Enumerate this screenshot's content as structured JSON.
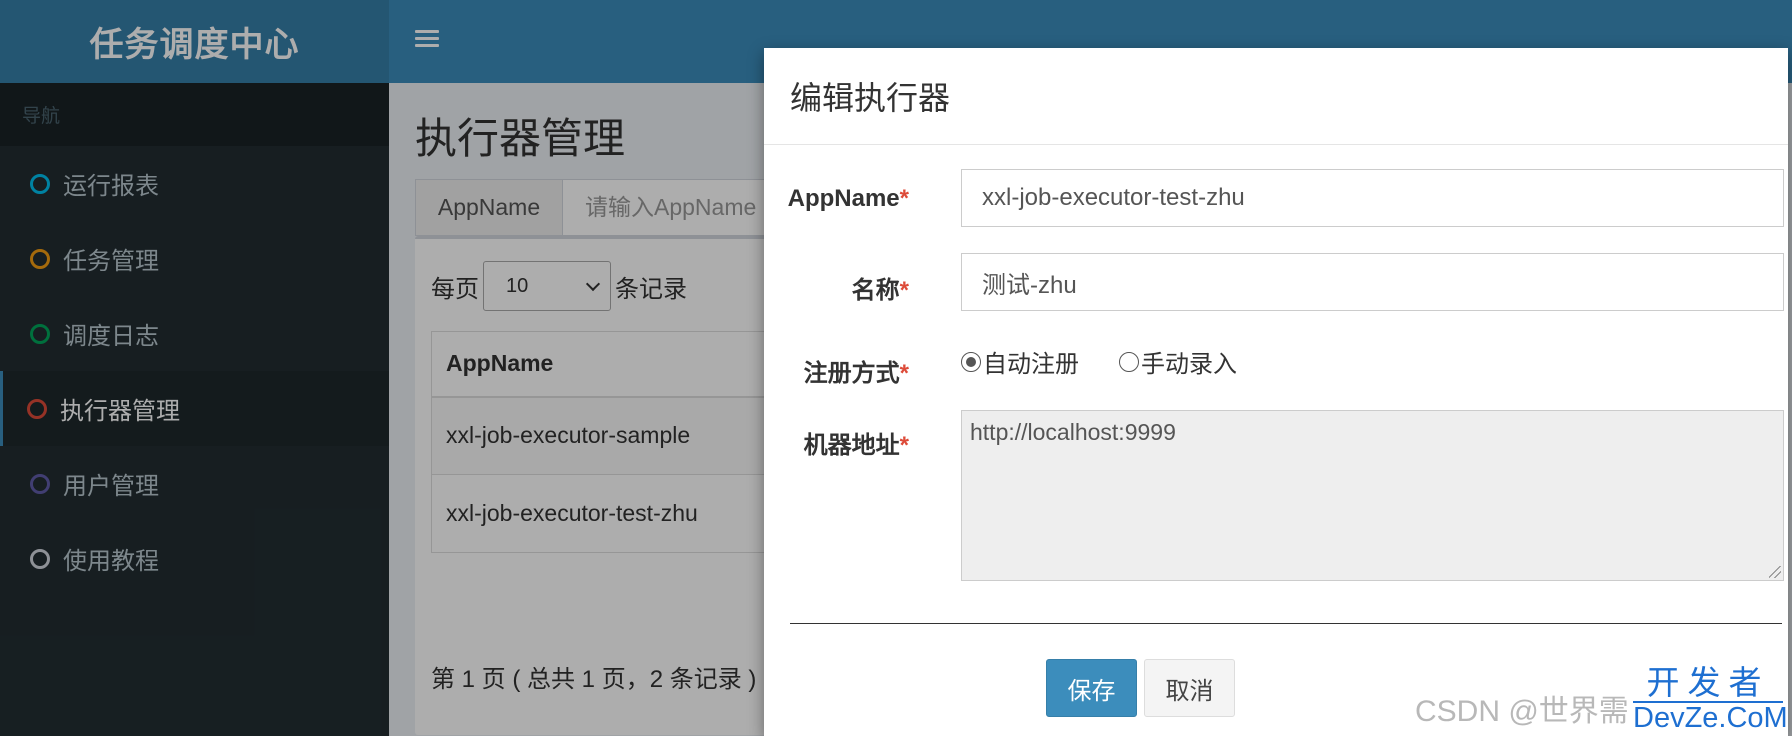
{
  "brand": {
    "title": "任务调度中心"
  },
  "sidebar": {
    "header": "导航",
    "items": [
      {
        "label": "运行报表",
        "icon": "circle-icon",
        "color": "#00c0ef"
      },
      {
        "label": "任务管理",
        "icon": "circle-icon",
        "color": "#f39c12"
      },
      {
        "label": "调度日志",
        "icon": "circle-icon",
        "color": "#00a65a"
      },
      {
        "label": "执行器管理",
        "icon": "circle-icon",
        "color": "#dd4b39"
      },
      {
        "label": "用户管理",
        "icon": "circle-icon",
        "color": "#605ca8"
      },
      {
        "label": "使用教程",
        "icon": "circle-icon",
        "color": "#d2d6de"
      }
    ],
    "active_index": 3
  },
  "topbar": {
    "menu_icon": "hamburger-icon"
  },
  "main": {
    "title": "执行器管理",
    "search": {
      "label": "AppName",
      "placeholder": "请输入AppName"
    },
    "length": {
      "prefix": "每页",
      "value": "10",
      "suffix": "条记录"
    },
    "table": {
      "columns": [
        "AppName"
      ],
      "rows": [
        "xxl-job-executor-sample",
        "xxl-job-executor-test-zhu"
      ]
    },
    "page_info": "第 1 页 ( 总共 1 页，2 条记录 )"
  },
  "modal": {
    "title": "编辑执行器",
    "fields": {
      "appname": {
        "label": "AppName",
        "value": "xxl-job-executor-test-zhu"
      },
      "name": {
        "label": "名称",
        "value": "测试-zhu"
      },
      "register": {
        "label": "注册方式",
        "options": [
          "自动注册",
          "手动录入"
        ],
        "selected": "自动注册"
      },
      "address": {
        "label": "机器地址",
        "value": "http://localhost:9999"
      }
    },
    "required_mark": "*",
    "save_label": "保存",
    "cancel_label": "取消"
  },
  "watermark": {
    "csdn": "CSDN @世界需",
    "devze_line1": "开发者",
    "devze_line2": "DevZe.CoM"
  },
  "colors": {
    "brand": "#367fa9",
    "header": "#3c8dbc",
    "sidebar": "#222d32",
    "required": "#dd4b39"
  }
}
